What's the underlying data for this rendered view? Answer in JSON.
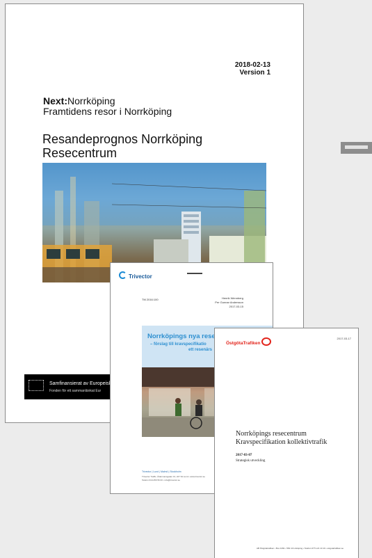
{
  "doc1": {
    "date": "2018-02-13",
    "version": "Version 1",
    "brand_bold": "Next:",
    "brand_rest": "Norrköping",
    "tagline": "Framtidens resor i Norrköping",
    "title_line1": "Resandeprognos Norrköping",
    "title_line2": "Resecentrum",
    "eu_line1": "Samfinansierat av Europeiska",
    "eu_line2": "Fonden för ett sammanlänkat Eur"
  },
  "doc2": {
    "logo": "Trivector",
    "ref": "TM 2016:100",
    "author1": "Henrik Wennberg",
    "author2": "Per Gunnar Andersson",
    "author_date": "2017-03-15",
    "headline": "Norrköpings nya rese",
    "sub1": "– förslag till kravspecifikatio",
    "sub2": "ett resenärs",
    "footer_links": "Trivector | Lund | Malmö | Stockholm",
    "footer_text1": "Trivector Traffic, Åldermansgatan 13, 227 64 Lund • www.trivector.se",
    "footer_text2": "Telefon 010-456 56 00 • info@trivector.se"
  },
  "doc3": {
    "logo": "ÖstgötaTrafiken",
    "date": "2017-03-17",
    "title_line1": "Norrköpings resecentrum",
    "title_line2": "Kravspecifikation kollektivtrafik",
    "sub_date": "2017-03-07",
    "subtitle": "Strategisk utveckling",
    "footer": "AB Östgötatrafiken • Box 1091 • 581 10 Linköping • Telefon 0771-21 10 10 • ostgotatrafiken.se"
  },
  "colors": {
    "trivector_blue": "#2d8fd0",
    "ostgota_red": "#e2231a",
    "background": "#ececec"
  }
}
